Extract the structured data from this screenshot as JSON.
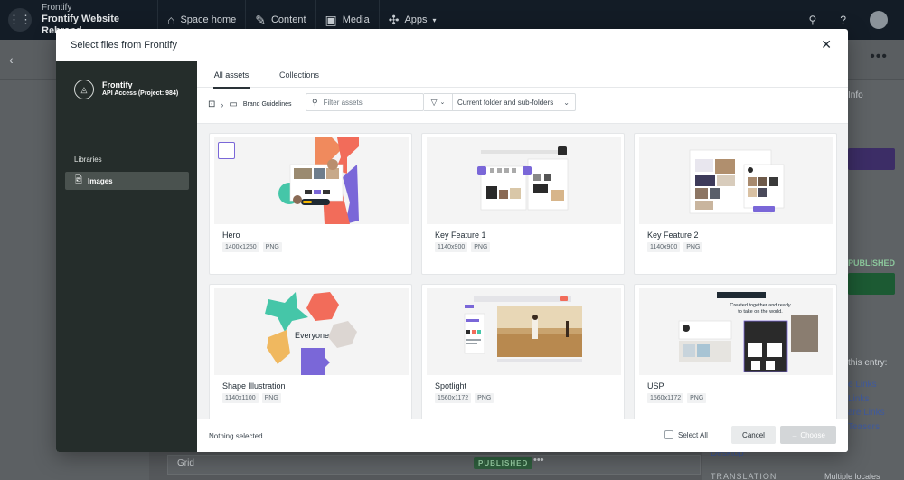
{
  "app": {
    "org": "Frontify",
    "space": "Frontify Website Rebrand",
    "nav": [
      {
        "label": "Space home",
        "icon": "home-icon"
      },
      {
        "label": "Content",
        "icon": "edit-icon"
      },
      {
        "label": "Media",
        "icon": "media-icon"
      },
      {
        "label": "Apps",
        "icon": "apps-icon"
      }
    ]
  },
  "background": {
    "info_label": "Info",
    "published_label": "PUBLISHED",
    "entry_label": "this entry:",
    "links": [
      "e Links",
      "Links",
      "are Links",
      "Teasers"
    ],
    "desktop_link": "Desktop",
    "translation_label": "TRANSLATION",
    "locales_label": "Multiple locales",
    "row_label": "Grid",
    "row_badge": "PUBLISHED"
  },
  "modal": {
    "title": "Select files from Frontify",
    "org": {
      "name": "Frontify",
      "sub": "API Access (Project: 984)"
    },
    "libraries_label": "Libraries",
    "libraries": [
      {
        "label": "Images",
        "active": true
      }
    ],
    "tabs": [
      {
        "label": "All assets",
        "active": true
      },
      {
        "label": "Collections",
        "active": false
      }
    ],
    "breadcrumb": "Brand Guidelines",
    "search": {
      "placeholder": "Filter assets",
      "value": ""
    },
    "scope": "Current folder and sub-folders",
    "assets": [
      {
        "name": "Hero",
        "dims": "1400x1250",
        "format": "PNG"
      },
      {
        "name": "Key Feature 1",
        "dims": "1140x900",
        "format": "PNG"
      },
      {
        "name": "Key Feature 2",
        "dims": "1140x900",
        "format": "PNG"
      },
      {
        "name": "Shape Illustration",
        "dims": "1140x1100",
        "format": "PNG"
      },
      {
        "name": "Spotlight",
        "dims": "1560x1172",
        "format": "PNG"
      },
      {
        "name": "USP",
        "dims": "1560x1172",
        "format": "PNG"
      }
    ],
    "shape_labels": {
      "center": "Everyone"
    },
    "usp_text": {
      "headline_1": "Created together and ready",
      "headline_2": "to take on the world."
    },
    "footer": {
      "status": "Nothing selected",
      "select_all": "Select All",
      "cancel": "Cancel",
      "choose": "→ Choose"
    }
  },
  "colors": {
    "accent": "#7a67d8",
    "sidebar": "#252d2b",
    "topbar": "#131c26"
  }
}
